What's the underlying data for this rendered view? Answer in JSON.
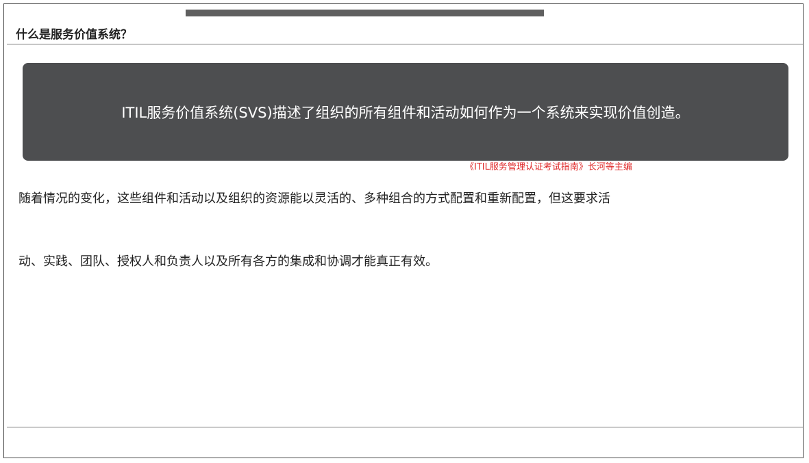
{
  "slide": {
    "title": "什么是服务价值系统？",
    "callout": {
      "text": "ITIL服务价值系统(SVS)描述了组织的所有组件和活动如何作为一个系统来实现价值创造。"
    },
    "citation": "《ITIL服务管理认证考试指南》长河等主编",
    "body": [
      "随着情况的变化，这些组件和活动以及组织的资源能以灵活的、多种组合的方式配置和重新配置，但这要求活",
      "动、实践、团队、授权人和负责人以及所有各方的集成和协调才能真正有效。"
    ]
  },
  "colors": {
    "callout_background": "#4d4e50",
    "top_bar": "#5f5f5f",
    "citation": "#e02a2a"
  }
}
